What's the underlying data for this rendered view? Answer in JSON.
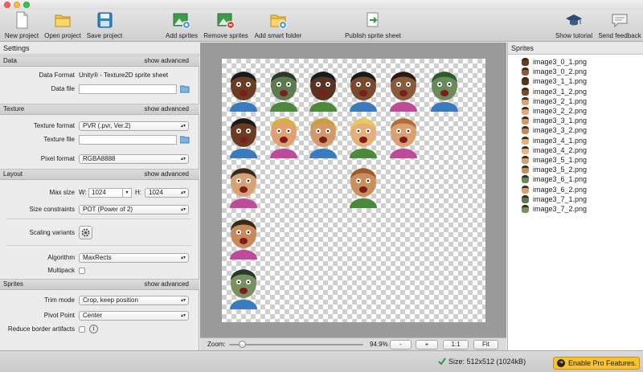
{
  "toolbar": {
    "new_project": "New project",
    "open_project": "Open project",
    "save_project": "Save project",
    "add_sprites": "Add sprites",
    "remove_sprites": "Remove sprites",
    "add_smart_folder": "Add smart folder",
    "publish": "Publish sprite sheet",
    "show_tutorial": "Show tutorial",
    "send_feedback": "Send feedback"
  },
  "settings": {
    "title": "Settings",
    "show_advanced": "show advanced",
    "data": {
      "header": "Data",
      "data_format_label": "Data Format",
      "data_format_value": "Unity® - Texture2D sprite sheet",
      "data_file_label": "Data file",
      "data_file_value": ""
    },
    "texture": {
      "header": "Texture",
      "texture_format_label": "Texture format",
      "texture_format_value": "PVR (.pvr, Ver.2)",
      "texture_file_label": "Texture file",
      "texture_file_value": "",
      "pixel_format_label": "Pixel format",
      "pixel_format_value": "RGBA8888"
    },
    "layout": {
      "header": "Layout",
      "max_size_label": "Max size",
      "w_label": "W:",
      "w_value": "1024",
      "h_label": "H:",
      "h_value": "1024",
      "size_constraints_label": "Size constraints",
      "size_constraints_value": "POT (Power of 2)",
      "scaling_variants_label": "Scaling variants",
      "algorithm_label": "Algorithm",
      "algorithm_value": "MaxRects",
      "multipack_label": "Multipack"
    },
    "sprites": {
      "header": "Sprites",
      "trim_mode_label": "Trim mode",
      "trim_mode_value": "Crop, keep position",
      "pivot_point_label": "Pivot Point",
      "pivot_point_value": "Center",
      "reduce_border_label": "Reduce border artifacts"
    }
  },
  "canvas": {
    "zoom_label": "Zoom:",
    "zoom_value": "94.9%",
    "zoom_out": "-",
    "zoom_in": "+",
    "one_to_one": "1:1",
    "fit": "Fit"
  },
  "sprites_panel": {
    "title": "Sprites",
    "items": [
      {
        "name": "image3_0_1.png",
        "skin": "#6b3b22"
      },
      {
        "name": "image3_0_2.png",
        "skin": "#8a5a3a"
      },
      {
        "name": "image3_1_1.png",
        "skin": "#5a3220"
      },
      {
        "name": "image3_1_2.png",
        "skin": "#7a4a2c"
      },
      {
        "name": "image3_2_1.png",
        "skin": "#e0a070"
      },
      {
        "name": "image3_2_2.png",
        "skin": "#e6a878"
      },
      {
        "name": "image3_3_1.png",
        "skin": "#d29a6a"
      },
      {
        "name": "image3_3_2.png",
        "skin": "#c88a5a"
      },
      {
        "name": "image3_4_1.png",
        "skin": "#e3b07c"
      },
      {
        "name": "image3_4_2.png",
        "skin": "#e8b582"
      },
      {
        "name": "image3_5_1.png",
        "skin": "#d9a070"
      },
      {
        "name": "image3_5_2.png",
        "skin": "#c9905e"
      },
      {
        "name": "image3_6_1.png",
        "skin": "#6a8a5a"
      },
      {
        "name": "image3_6_2.png",
        "skin": "#d8a274"
      },
      {
        "name": "image3_7_1.png",
        "skin": "#5e7a4e"
      },
      {
        "name": "image3_7_2.png",
        "skin": "#7a9060"
      }
    ]
  },
  "status": {
    "size_text": "Size: 512x512 (1024kB)",
    "pro_button": "Enable Pro Features."
  }
}
